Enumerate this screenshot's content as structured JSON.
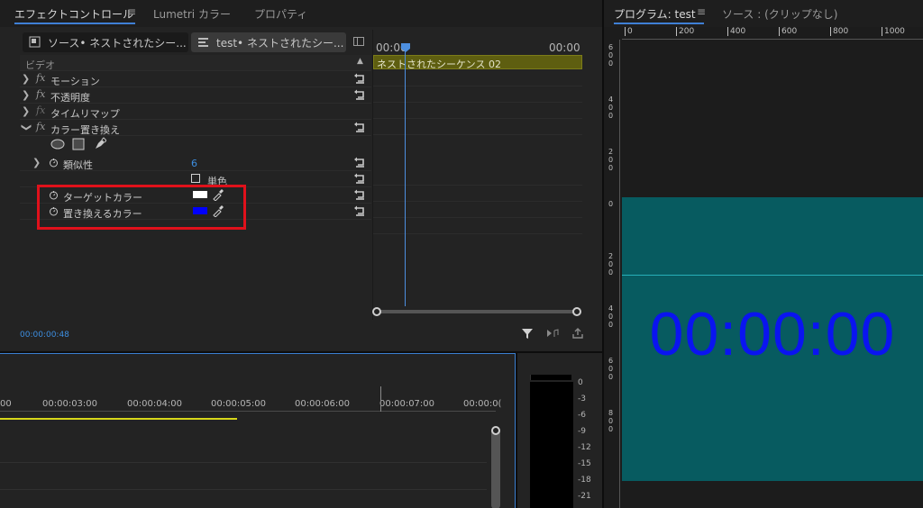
{
  "effect_controls": {
    "tabs": [
      {
        "label": "エフェクトコントロール",
        "active": true
      },
      {
        "label": "Lumetri カラー",
        "active": false
      },
      {
        "label": "プロパティ",
        "active": false
      }
    ],
    "source_tab": "ソース• ネストされたシー...",
    "sequence_tab": "test• ネストされたシー...",
    "section_video": "ビデオ",
    "effects": [
      {
        "label": "モーション"
      },
      {
        "label": "不透明度"
      },
      {
        "label": "タイムリマップ"
      },
      {
        "label": "カラー置き換え"
      }
    ],
    "params": {
      "similarity_label": "類似性",
      "similarity_value": "6",
      "solid_colors_label": "単色",
      "target_color_label": "ターゲットカラー",
      "target_color": "#ffffff",
      "replace_color_label": "置き換えるカラー",
      "replace_color": "#0000ff"
    },
    "ruler_start": "00:00",
    "ruler_end": "00:00",
    "clip_name": "ネストされたシーケンス 02",
    "current_time": "00:00:00:48",
    "highlight_color": "#e0111b"
  },
  "program_monitor": {
    "title": "プログラム: test",
    "source_title": "ソース : (クリップなし)",
    "ruler_ticks": [
      "0",
      "200",
      "400",
      "600",
      "800",
      "1000"
    ],
    "left_ruler_groups": [
      "600",
      "400",
      "200",
      "0",
      "200",
      "400",
      "600",
      "800"
    ],
    "timecode": "00:00:00",
    "teal_color": "#075b60"
  },
  "timeline": {
    "timecodes": [
      "00",
      "00:00:03:00",
      "00:00:04:00",
      "00:00:05:00",
      "00:00:06:00",
      "00:00:07:00",
      "00:00:0("
    ]
  },
  "audio_meter": {
    "db_labels": [
      "0",
      "-3",
      "-6",
      "-9",
      "-12",
      "-15",
      "-18",
      "-21"
    ]
  }
}
